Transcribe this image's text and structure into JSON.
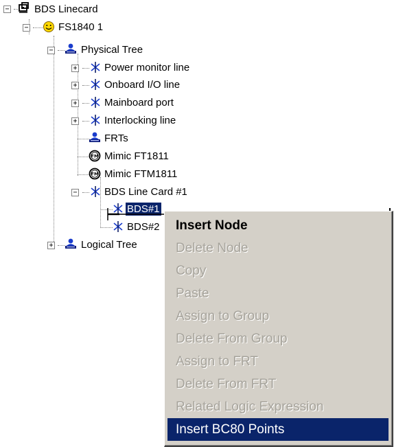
{
  "tree": {
    "root": {
      "label": "BDS Linecard",
      "icon": "network-card-icon",
      "toggle": "−"
    },
    "controller": {
      "label": "FS1840 1",
      "icon": "smiley-icon",
      "toggle": "−"
    },
    "physical_tree": {
      "label": "Physical Tree",
      "icon": "computer-user-icon",
      "toggle": "−"
    },
    "power_monitor": {
      "label": "Power monitor line",
      "icon": "asterisk-node-icon",
      "toggle": "+"
    },
    "onboard_io": {
      "label": "Onboard I/O line",
      "icon": "asterisk-node-icon",
      "toggle": "+"
    },
    "mainboard_port": {
      "label": "Mainboard port",
      "icon": "asterisk-node-icon",
      "toggle": "+"
    },
    "interlocking_line": {
      "label": "Interlocking line",
      "icon": "asterisk-node-icon",
      "toggle": "+"
    },
    "frts": {
      "label": "FRTs",
      "icon": "computer-user-icon"
    },
    "mimic_ft1811": {
      "label": "Mimic FT1811",
      "icon": "fm-badge-icon"
    },
    "mimic_ftm1811": {
      "label": "Mimic FTM1811",
      "icon": "fm-badge-icon"
    },
    "bds_line_card": {
      "label": "BDS Line Card #1",
      "icon": "asterisk-node-icon",
      "toggle": "−"
    },
    "bds1": {
      "label": "BDS#1",
      "icon": "asterisk-node-icon"
    },
    "bds2": {
      "label": "BDS#2",
      "icon": "asterisk-node-icon"
    },
    "logical_tree": {
      "label": "Logical Tree",
      "icon": "computer-user-icon",
      "toggle": "+"
    }
  },
  "context_menu": {
    "items": [
      {
        "label": "Insert Node",
        "state": "bold"
      },
      {
        "label": "Delete Node",
        "state": "disabled"
      },
      {
        "label": "Copy",
        "state": "disabled"
      },
      {
        "label": "Paste",
        "state": "disabled"
      },
      {
        "label": "Assign to Group",
        "state": "disabled"
      },
      {
        "label": "Delete From Group",
        "state": "disabled"
      },
      {
        "label": "Assign to FRT",
        "state": "disabled"
      },
      {
        "label": "Delete From FRT",
        "state": "disabled"
      },
      {
        "label": "Related Logic Expression",
        "state": "disabled"
      },
      {
        "label": "Insert BC80 Points",
        "state": "highlighted"
      }
    ]
  },
  "colors": {
    "selection": "#0a246a",
    "menu_background": "#d4d0c8",
    "disabled_text": "#a6a39b",
    "asterisk_blue": "#1a3ccc",
    "smiley_yellow": "#ffd800"
  }
}
